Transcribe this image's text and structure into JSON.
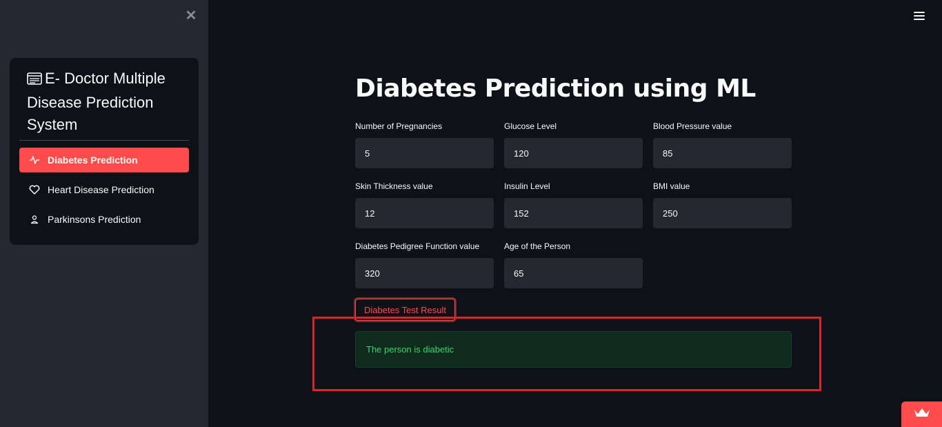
{
  "sidebar": {
    "title": "E- Doctor Multiple Disease Prediction System",
    "items": [
      {
        "label": "Diabetes Prediction",
        "icon": "activity-icon",
        "active": true
      },
      {
        "label": "Heart Disease Prediction",
        "icon": "heart-icon",
        "active": false
      },
      {
        "label": "Parkinsons Prediction",
        "icon": "person-icon",
        "active": false
      }
    ]
  },
  "main": {
    "title": "Diabetes Prediction using ML",
    "fields": [
      {
        "label": "Number of Pregnancies",
        "value": "5"
      },
      {
        "label": "Glucose Level",
        "value": "120"
      },
      {
        "label": "Blood Pressure value",
        "value": "85"
      },
      {
        "label": "Skin Thickness value",
        "value": "12"
      },
      {
        "label": "Insulin Level",
        "value": "152"
      },
      {
        "label": "BMI value",
        "value": "250"
      },
      {
        "label": "Diabetes Pedigree Function value",
        "value": "320"
      },
      {
        "label": "Age of the Person",
        "value": "65"
      }
    ],
    "button_label": "Diabetes Test Result",
    "result_text": "The person is diabetic"
  },
  "colors": {
    "accent": "#ff4b4b",
    "sidebar_bg": "#262730",
    "main_bg": "#0e1117",
    "success_text": "#3dd56d",
    "success_bg": "#0f2b1e",
    "highlight_border": "#e0232a"
  }
}
